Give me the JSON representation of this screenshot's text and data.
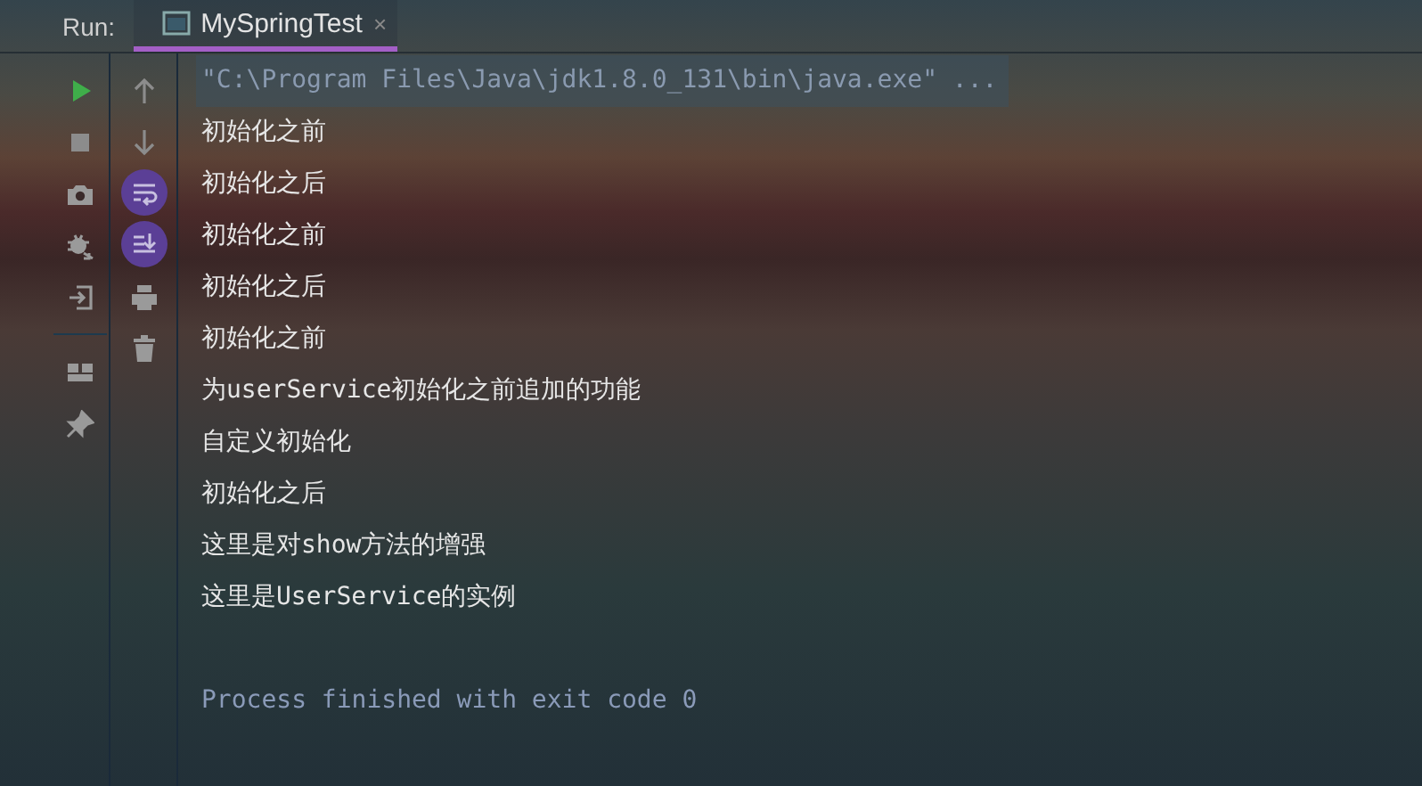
{
  "run_panel": {
    "label": "Run:",
    "tabs": [
      {
        "label": "MySpringTest",
        "selected": true,
        "close": "×"
      }
    ]
  },
  "left_toolbar": [
    {
      "kind": "run"
    },
    {
      "kind": "stop"
    },
    {
      "kind": "camera"
    },
    {
      "kind": "bug"
    },
    {
      "kind": "login"
    },
    {
      "kind": "separator"
    },
    {
      "kind": "layout"
    },
    {
      "kind": "pin"
    }
  ],
  "right_toolbar": [
    {
      "kind": "up",
      "on": false
    },
    {
      "kind": "down",
      "on": false
    },
    {
      "kind": "wrap",
      "on": true
    },
    {
      "kind": "scroll-end",
      "on": true
    },
    {
      "kind": "print",
      "on": false
    },
    {
      "kind": "trash",
      "on": false
    }
  ],
  "console": [
    {
      "kind": "command",
      "text": "\"C:\\Program Files\\Java\\jdk1.8.0_131\\bin\\java.exe\" ..."
    },
    {
      "kind": "output",
      "text": "初始化之前"
    },
    {
      "kind": "output",
      "text": "初始化之后"
    },
    {
      "kind": "output",
      "text": "初始化之前"
    },
    {
      "kind": "output",
      "text": "初始化之后"
    },
    {
      "kind": "output",
      "text": "初始化之前"
    },
    {
      "kind": "output",
      "text": "为userService初始化之前追加的功能"
    },
    {
      "kind": "output",
      "text": "自定义初始化"
    },
    {
      "kind": "output",
      "text": "初始化之后"
    },
    {
      "kind": "output",
      "text": "这里是对show方法的增强"
    },
    {
      "kind": "output",
      "text": "这里是UserService的实例"
    },
    {
      "kind": "blank"
    },
    {
      "kind": "exit",
      "text": "Process finished with exit code 0"
    }
  ]
}
